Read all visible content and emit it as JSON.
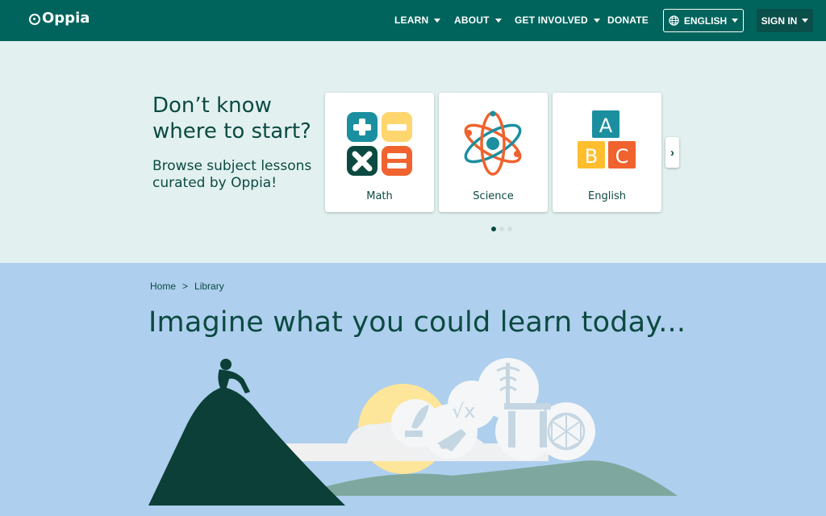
{
  "nav": {
    "logo": "Oppia",
    "items": [
      {
        "label": "LEARN",
        "dropdown": true
      },
      {
        "label": "ABOUT",
        "dropdown": true
      },
      {
        "label": "GET INVOLVED",
        "dropdown": true
      },
      {
        "label": "DONATE",
        "dropdown": false
      }
    ],
    "language": "ENGLISH",
    "sign_in": "SIGN IN"
  },
  "hero": {
    "title": "Don’t know where to start?",
    "subtitle": "Browse subject lessons curated by Oppia!",
    "cards": [
      {
        "label": "Math",
        "icon": "math-symbols-icon"
      },
      {
        "label": "Science",
        "icon": "atom-icon"
      },
      {
        "label": "English",
        "icon": "abc-blocks-icon"
      }
    ],
    "next_icon": "›",
    "carousel_pages": 3,
    "active_page": 0
  },
  "library": {
    "breadcrumb": [
      "Home",
      ">",
      "Library"
    ],
    "title": "Imagine what you could learn today..."
  },
  "colors": {
    "nav_bg": "#00645c",
    "hero_bg": "#e2f1f0",
    "library_bg": "#aecfee",
    "text_dark": "#0c4a41"
  }
}
